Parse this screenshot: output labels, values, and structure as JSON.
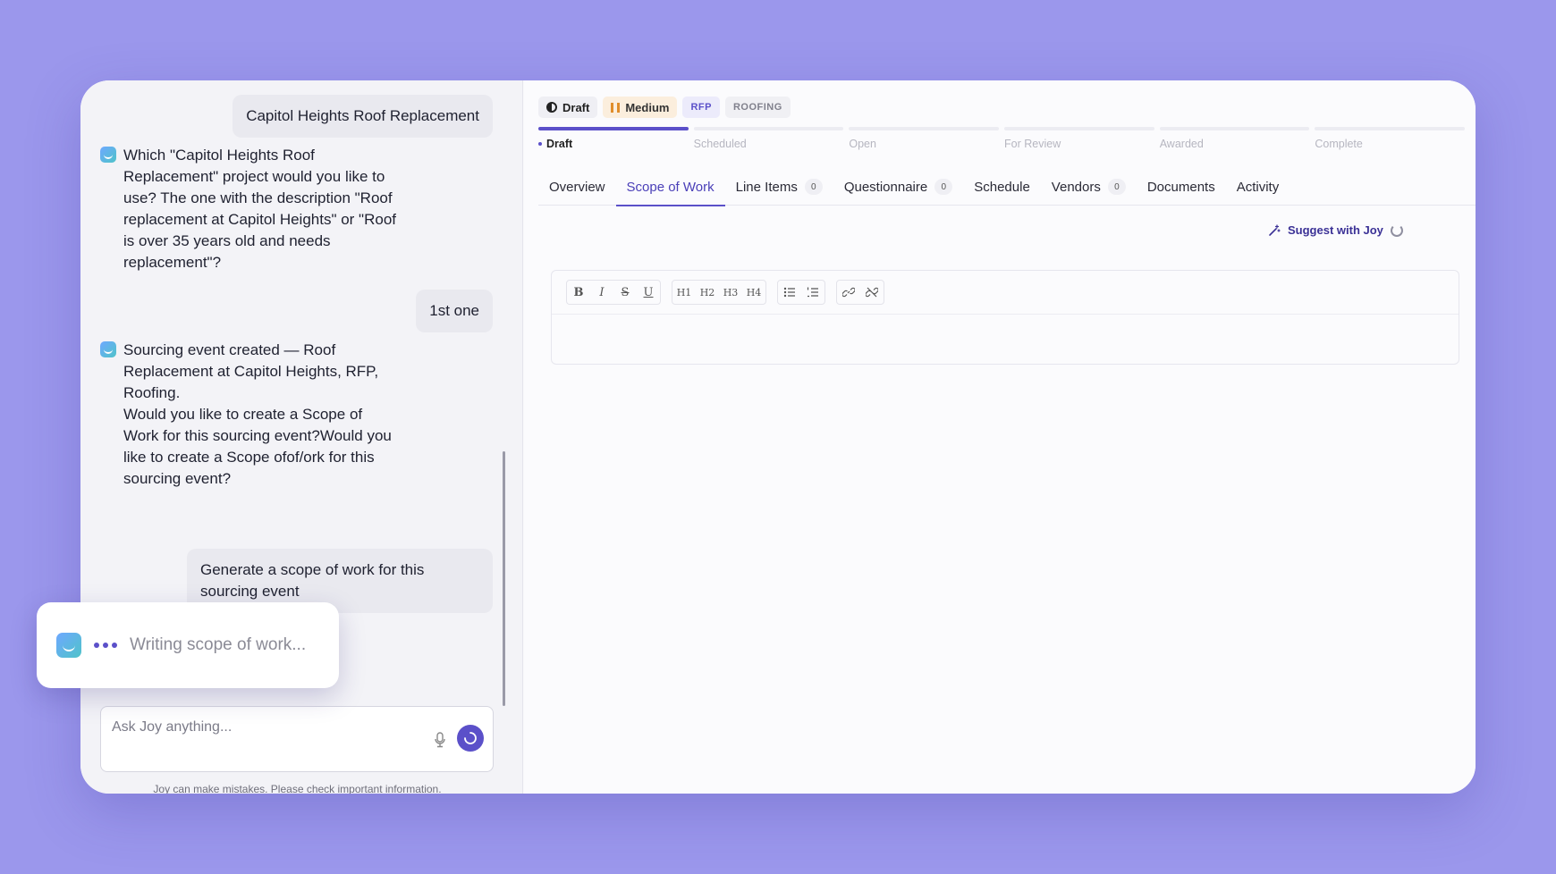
{
  "chat": {
    "messages": [
      {
        "role": "user",
        "text": "Capitol Heights Roof Replacement"
      },
      {
        "role": "bot",
        "text": "Which \"Capitol Heights Roof Replacement\" project would you like to use? The one with the description \"Roof replacement at Capitol Heights\" or \"Roof is over 35 years old and needs replacement\"?"
      },
      {
        "role": "user",
        "text": "1st one"
      },
      {
        "role": "bot",
        "text": "Sourcing event created — Roof Replacement at Capitol Heights, RFP, Roofing.\nWould you like to create a Scope of Work for this sourcing event?Would you like to create a Scope ofof/ork for this sourcing event?"
      },
      {
        "role": "user",
        "text": "Generate a scope of work for this sourcing event"
      }
    ],
    "input_placeholder": "Ask Joy anything...",
    "disclaimer": "Joy can make mistakes. Please check important information."
  },
  "status_card": {
    "text": "Writing scope of work..."
  },
  "header": {
    "badges": [
      {
        "label": "Draft",
        "icon": "half-circle-icon"
      },
      {
        "label": "Medium",
        "icon": "pause-icon",
        "color": "#e08d2a"
      },
      {
        "label": "RFP"
      },
      {
        "label": "ROOFING"
      }
    ],
    "stages": [
      "Draft",
      "Scheduled",
      "Open",
      "For Review",
      "Awarded",
      "Complete"
    ],
    "active_stage": "Draft"
  },
  "tabs": [
    {
      "label": "Overview"
    },
    {
      "label": "Scope of Work",
      "active": true
    },
    {
      "label": "Line Items",
      "count": "0"
    },
    {
      "label": "Questionnaire",
      "count": "0"
    },
    {
      "label": "Schedule"
    },
    {
      "label": "Vendors",
      "count": "0"
    },
    {
      "label": "Documents"
    },
    {
      "label": "Activity"
    }
  ],
  "editor": {
    "suggest_label": "Suggest with Joy",
    "toolbar": [
      [
        "B",
        "I",
        "S",
        "U"
      ],
      [
        "H1",
        "H2",
        "H3",
        "H4"
      ],
      [
        "bullet-list-icon",
        "numbered-list-icon"
      ],
      [
        "link-icon",
        "unlink-icon"
      ]
    ]
  },
  "colors": {
    "accent": "#5b50c9",
    "background": "#9b97ec"
  }
}
